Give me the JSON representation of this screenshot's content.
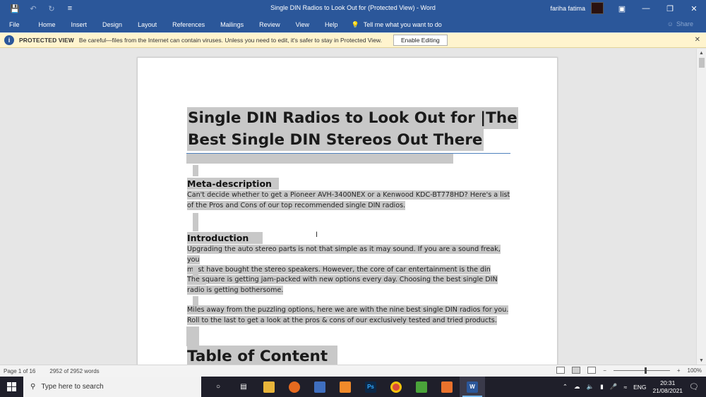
{
  "window": {
    "title": "Single DIN Radios to Look Out for (Protected View)  -  Word",
    "user_name": "fariha fatima",
    "controls": [
      "ribbon-display",
      "minimize",
      "restore",
      "close"
    ]
  },
  "ribbon": {
    "tabs": [
      "File",
      "Home",
      "Insert",
      "Design",
      "Layout",
      "References",
      "Mailings",
      "Review",
      "View",
      "Help"
    ],
    "tell_me": "Tell me what you want to do",
    "share": "Share"
  },
  "protected_view": {
    "label": "PROTECTED VIEW",
    "message": "Be careful—files from the Internet can contain viruses. Unless you need to edit, it's safer to stay in Protected View.",
    "button": "Enable Editing"
  },
  "document": {
    "title_line1": "Single DIN Radios to Look Out for |The",
    "title_line2": "Best Single DIN Stereos Out There",
    "sections": [
      {
        "heading": "Meta-description",
        "paragraphs": [
          [
            "Can't decide whether to get a Pioneer AVH-3400NEX or a Kenwood KDC-BT778HD? Here's a list",
            "of the Pros and Cons of our top recommended single DIN radios."
          ]
        ]
      },
      {
        "heading": "Introduction",
        "paragraphs": [
          [
            "Upgrading the auto stereo parts is not that simple as it may sound. If you are a sound freak, you",
            "must have bought the stereo speakers. However, the core of car entertainment is the din radio."
          ],
          [
            "The square is getting jam-packed with new options every day. Choosing the best single DIN",
            "radio is getting bothersome."
          ],
          [
            "Miles away from the puzzling options, here we are with the nine best single DIN radios for you.",
            "Roll to the last to get a look at the pros & cons of our exclusively tested and tried products."
          ]
        ]
      }
    ],
    "next_heading": "Table of Content"
  },
  "status_bar": {
    "page": "Page 1 of 16",
    "words": "2952 of 2952 words",
    "zoom": "100%",
    "zoom_minus": "−",
    "zoom_plus": "+"
  },
  "taskbar": {
    "search_placeholder": "Type here to search",
    "apps": [
      "cortana",
      "task-view",
      "file-explorer",
      "firefox",
      "store",
      "xampp",
      "photoshop",
      "chrome",
      "camtasia",
      "recorder",
      "word"
    ],
    "language": "ENG",
    "time": "20:31",
    "date": "21/08/2021"
  },
  "colors": {
    "word_blue": "#2b579a",
    "protected_bar": "#fff4ce",
    "selection": "#c8c8c8",
    "heading_rule": "#4f81bd"
  }
}
